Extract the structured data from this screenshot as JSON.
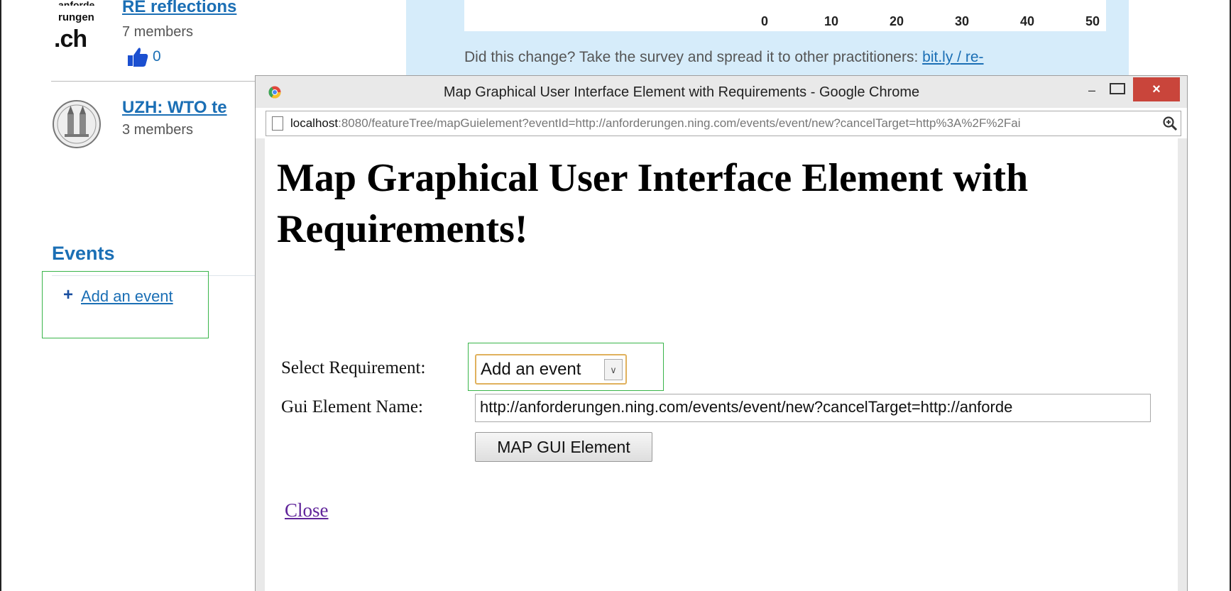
{
  "background_page": {
    "group1": {
      "logo_line1": "anforde",
      "logo_line2": "rungen",
      "logo_line3": ".ch",
      "title": "RE reflections",
      "members": "7 members",
      "likes": "0"
    },
    "group2": {
      "title": "UZH: WTO te",
      "members": "3 members"
    },
    "events": {
      "heading": "Events",
      "add_icon": "+",
      "add_link": "Add an event"
    },
    "survey": {
      "axis_ticks": [
        "0",
        "10",
        "20",
        "30",
        "40",
        "50"
      ],
      "text": "Did this change? Take the survey and spread it to other practitioners: ",
      "link": "bit.ly / re-"
    }
  },
  "popup": {
    "window_title": "Map Graphical User Interface Element with Requirements - Google Chrome",
    "minimize": "–",
    "close": "×",
    "url_host": "localhost",
    "url_rest": ":8080/featureTree/mapGuielement?eventId=http://anforderungen.ning.com/events/event/new?cancelTarget=http%3A%2F%2Fai",
    "heading": "Map Graphical User Interface Element with Requirements!",
    "form": {
      "select_label": "Select Requirement:",
      "select_value": "Add an event",
      "name_label": "Gui Element Name:",
      "name_value": "http://anforderungen.ning.com/events/event/new?cancelTarget=http://anforde",
      "button_label": "MAP GUI Element"
    },
    "close_link": "Close"
  },
  "colors": {
    "highlight": "#3ab54a",
    "link": "#1b6fb5",
    "survey_panel": "#d6ecfa",
    "close_button": "#c9453b"
  },
  "icons": [
    "thumbs-up-icon",
    "chrome-icon",
    "page-icon",
    "zoom-icon",
    "uzh-seal-icon",
    "plus-icon",
    "dropdown-arrow-icon"
  ]
}
